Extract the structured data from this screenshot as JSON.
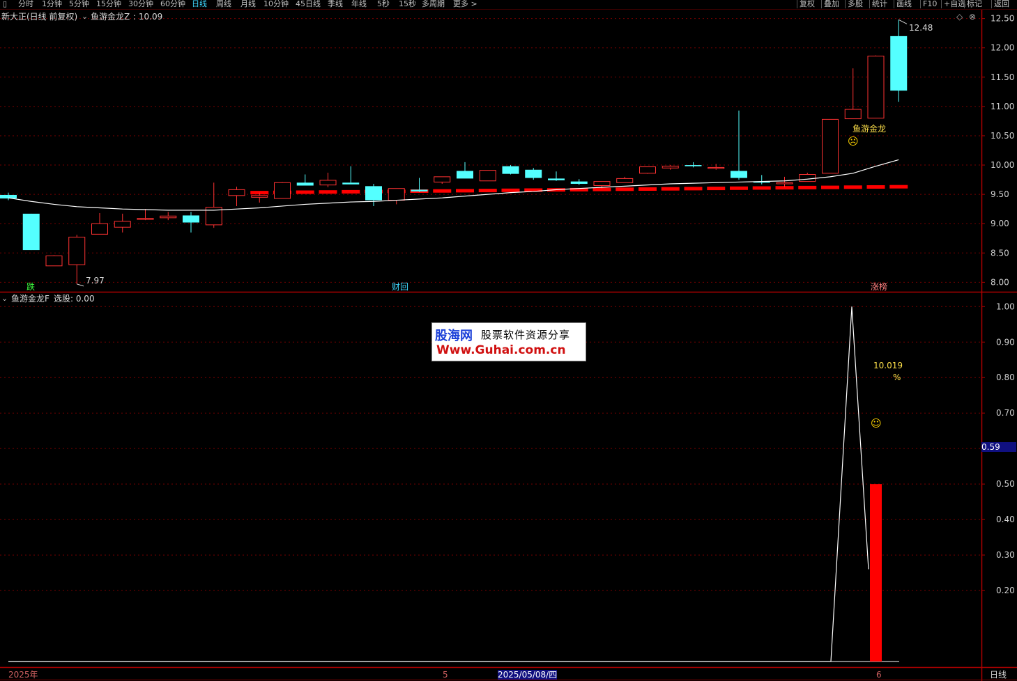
{
  "toolbar": {
    "left_items": [
      "分时",
      "1分钟",
      "5分钟",
      "15分钟",
      "30分钟",
      "60分钟",
      "日线",
      "周线",
      "月线",
      "10分钟",
      "45日线",
      "季线",
      "年线",
      "5秒",
      "15秒",
      "多周期",
      "更多 >"
    ],
    "active": "日线",
    "right_items": [
      "复权",
      "叠加",
      "多股",
      "统计",
      "画线",
      "F10",
      "+自选",
      "标记",
      "返回"
    ]
  },
  "main_panel": {
    "title": "新大正(日线 前复权)",
    "indicator": "鱼游金龙Z",
    "indicator_value": ": 10.09",
    "high_label": "12.48",
    "low_label": "7.97",
    "signal_text": "鱼游金龙",
    "marker_left": "跌",
    "marker_mid": "财回",
    "marker_right": "涨榜"
  },
  "sub_panel": {
    "title": "鱼游金龙F",
    "value_label": "选股: 0.00",
    "pct_value": "10.019",
    "pct_unit": "%",
    "cursor_value": "0.59"
  },
  "xaxis": {
    "year_label": "2025年",
    "month5": "5",
    "cursor_date": "2025/05/08/四",
    "month6": "6",
    "period": "日线"
  },
  "watermark": {
    "logo": "股海网",
    "slogan": "股票软件资源分享",
    "url": "Www.Guhai.com.cn"
  },
  "colors": {
    "up": "#ff3232",
    "down": "#54ffff",
    "ma": "#ffffff",
    "bar": "#ff0000",
    "grid": "#7a0000",
    "text": "#c0c0c0"
  },
  "chart_data": [
    {
      "type": "candlestick",
      "ylim": [
        7.85,
        12.65
      ],
      "yticks": [
        8.0,
        8.5,
        9.0,
        9.5,
        10.0,
        10.5,
        11.0,
        11.5,
        12.0,
        12.5
      ],
      "candles": [
        [
          9.49,
          9.53,
          9.4,
          9.43
        ],
        [
          9.17,
          9.17,
          8.55,
          8.55
        ],
        [
          8.28,
          8.46,
          8.28,
          8.45
        ],
        [
          8.3,
          8.81,
          7.97,
          8.77
        ],
        [
          8.82,
          9.18,
          8.82,
          9.0
        ],
        [
          8.94,
          9.17,
          8.85,
          9.04
        ],
        [
          9.08,
          9.25,
          9.06,
          9.09
        ],
        [
          9.1,
          9.2,
          9.06,
          9.13
        ],
        [
          9.14,
          9.2,
          8.85,
          9.02
        ],
        [
          8.98,
          9.7,
          8.93,
          9.28
        ],
        [
          9.48,
          9.63,
          9.3,
          9.58
        ],
        [
          9.45,
          9.53,
          9.36,
          9.48
        ],
        [
          9.43,
          9.71,
          9.43,
          9.7
        ],
        [
          9.7,
          9.84,
          9.67,
          9.65
        ],
        [
          9.66,
          9.87,
          9.62,
          9.74
        ],
        [
          9.7,
          9.98,
          9.7,
          9.67
        ],
        [
          9.64,
          9.68,
          9.3,
          9.4
        ],
        [
          9.4,
          9.6,
          9.33,
          9.6
        ],
        [
          9.58,
          9.78,
          9.54,
          9.55
        ],
        [
          9.71,
          9.79,
          9.68,
          9.8
        ],
        [
          9.9,
          10.05,
          9.88,
          9.77
        ],
        [
          9.73,
          9.9,
          9.73,
          9.91
        ],
        [
          9.98,
          10.0,
          9.84,
          9.85
        ],
        [
          9.92,
          9.95,
          9.75,
          9.78
        ],
        [
          9.77,
          9.89,
          9.73,
          9.74
        ],
        [
          9.72,
          9.76,
          9.66,
          9.68
        ],
        [
          9.65,
          9.72,
          9.6,
          9.72
        ],
        [
          9.7,
          9.8,
          9.7,
          9.77
        ],
        [
          9.86,
          9.96,
          9.85,
          9.97
        ],
        [
          9.95,
          10.0,
          9.92,
          9.98
        ],
        [
          10.0,
          10.05,
          9.96,
          9.98
        ],
        [
          9.96,
          10.02,
          9.92,
          9.96
        ],
        [
          9.9,
          10.93,
          9.75,
          9.78
        ],
        [
          9.72,
          9.83,
          9.67,
          9.7
        ],
        [
          9.68,
          9.8,
          9.62,
          9.7
        ],
        [
          9.72,
          9.87,
          9.72,
          9.84
        ],
        [
          9.86,
          10.78,
          9.86,
          10.78
        ],
        [
          10.79,
          11.65,
          10.79,
          10.95
        ],
        [
          10.8,
          11.87,
          10.8,
          11.86
        ],
        [
          12.2,
          12.48,
          11.08,
          11.27
        ]
      ],
      "ma": [
        9.44,
        9.38,
        9.33,
        9.29,
        9.27,
        9.25,
        9.24,
        9.23,
        9.23,
        9.23,
        9.25,
        9.27,
        9.3,
        9.33,
        9.35,
        9.37,
        9.38,
        9.4,
        9.42,
        9.44,
        9.47,
        9.5,
        9.53,
        9.55,
        9.58,
        9.6,
        9.62,
        9.64,
        9.66,
        9.68,
        9.69,
        9.7,
        9.71,
        9.72,
        9.73,
        9.76,
        9.8,
        9.86,
        9.98,
        10.09
      ],
      "support_line": {
        "from_index": 11,
        "start": 9.53,
        "end": 9.63
      }
    },
    {
      "type": "line+bar",
      "ylim": [
        0,
        1.03
      ],
      "yticks": [
        0.2,
        0.3,
        0.4,
        0.5,
        0.6,
        0.7,
        0.8,
        0.9,
        1.0
      ],
      "line_points": [
        [
          0,
          0.0
        ],
        [
          36,
          0.0
        ],
        [
          37,
          1.0
        ],
        [
          37.8,
          0.26
        ]
      ],
      "bar": {
        "index": 38,
        "value": 0.5
      }
    }
  ]
}
